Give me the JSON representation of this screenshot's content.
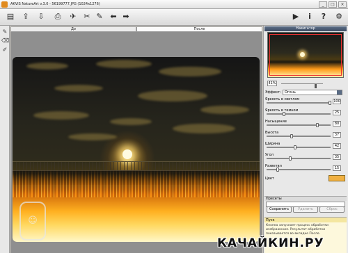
{
  "window": {
    "title": "AKVIS NatureArt v.3.0 - 56199777.JPG (1024x1276)",
    "controls": [
      "_",
      "□",
      "×"
    ]
  },
  "toolbar": {
    "left_icons": [
      "open-file-icon",
      "save-file-icon",
      "export-icon",
      "print-icon",
      "share-icon",
      "settings-tool-icon",
      "hand-tool-icon",
      "undo-icon",
      "redo-icon"
    ],
    "right_icons": [
      "run-icon",
      "info-icon",
      "help-icon",
      "preferences-icon"
    ],
    "glyphs": {
      "run": "▶",
      "info": "i",
      "help": "?",
      "prefs": "⚙"
    }
  },
  "tabs": [
    {
      "label": "До",
      "active": false
    },
    {
      "label": "После",
      "active": true
    }
  ],
  "navigator": {
    "title": "Навигатор"
  },
  "zoom": {
    "value": "41%"
  },
  "effect": {
    "label": "Эффект:",
    "value": "Огонь"
  },
  "params": [
    {
      "label": "Яркость в светлом",
      "value": "100"
    },
    {
      "label": "Яркость в темном",
      "value": "25"
    },
    {
      "label": "Насыщение",
      "value": "80"
    },
    {
      "label": "Высота",
      "value": "37"
    },
    {
      "label": "Ширина",
      "value": "42"
    },
    {
      "label": "Угол",
      "value": "35"
    },
    {
      "label": "Разветвл",
      "value": "15"
    }
  ],
  "color": {
    "label": "Цвет",
    "hex": "#f0b041"
  },
  "presets": {
    "title": "Пресеты",
    "save": "Сохранить",
    "delete": "Удалить",
    "reset": "Сброс"
  },
  "help": {
    "title": "Пуск",
    "text": "Кнопка запускает процесс обработки изображения. Результат обработки показывается во вкладке После."
  },
  "watermark": "КАЧАЙКИН.РУ"
}
